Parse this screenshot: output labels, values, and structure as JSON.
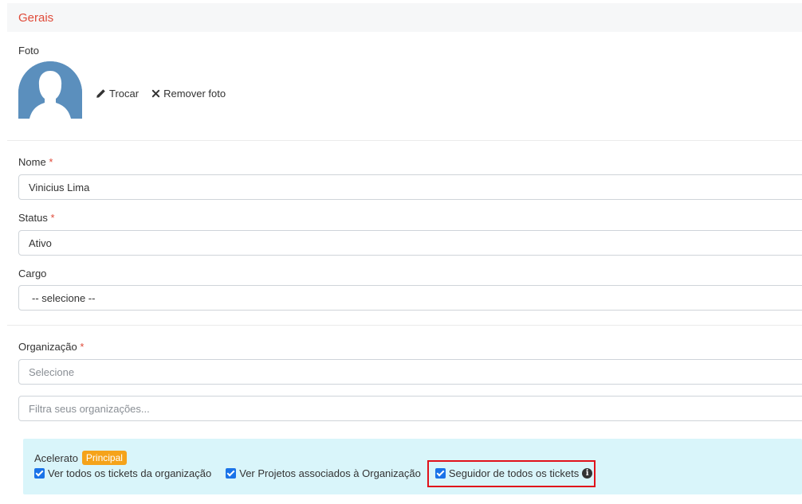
{
  "header": {
    "title": "Gerais"
  },
  "photo": {
    "label": "Foto",
    "change_label": "Trocar",
    "remove_label": "Remover foto"
  },
  "fields": {
    "name": {
      "label": "Nome",
      "required_mark": "*",
      "value": "Vinicius Lima"
    },
    "status": {
      "label": "Status",
      "required_mark": "*",
      "value": "Ativo"
    },
    "cargo": {
      "label": "Cargo",
      "value": "-- selecione --"
    },
    "organization": {
      "label": "Organização",
      "required_mark": "*",
      "placeholder": "Selecione",
      "filter_placeholder": "Filtra seus organizações..."
    }
  },
  "organization_entry": {
    "name": "Acelerato",
    "badge": "Principal",
    "checks": [
      {
        "label": "Ver todos os tickets da organização",
        "checked": true
      },
      {
        "label": "Ver Projetos associados à Organização",
        "checked": true
      },
      {
        "label": "Seguidor de todos os tickets",
        "checked": true
      }
    ]
  },
  "colors": {
    "accent_red": "#e04b3a",
    "avatar_blue": "#5b8fbd",
    "badge_orange": "#f5a31a",
    "info_bg": "#d9f5fa",
    "checkbox_blue": "#1a73e8",
    "highlight_red": "#e0121b"
  }
}
